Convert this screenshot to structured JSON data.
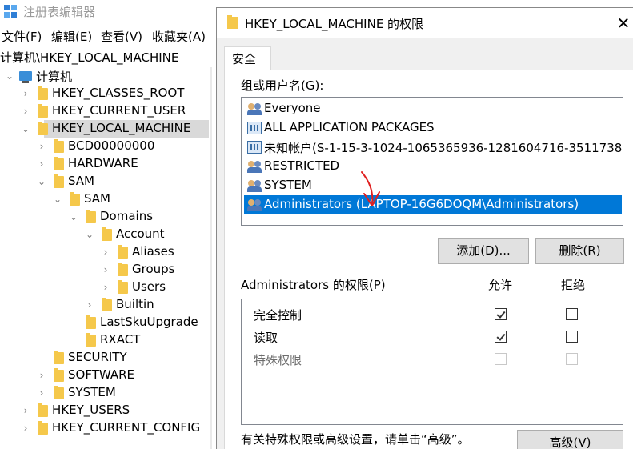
{
  "regedit": {
    "title": "注册表编辑器",
    "menu": [
      "文件(F)",
      "编辑(E)",
      "查看(V)",
      "收藏夹(A)"
    ],
    "address": "计算机\\HKEY_LOCAL_MACHINE",
    "tree": [
      {
        "label": "计算机",
        "chev": "⌄",
        "pc": true
      },
      {
        "label": "HKEY_CLASSES_ROOT",
        "chev": "›"
      },
      {
        "label": "HKEY_CURRENT_USER",
        "chev": "›"
      },
      {
        "label": "HKEY_LOCAL_MACHINE",
        "chev": "⌄",
        "selected": true
      },
      {
        "label": "BCD00000000",
        "chev": "›"
      },
      {
        "label": "HARDWARE",
        "chev": "›"
      },
      {
        "label": "SAM",
        "chev": "⌄"
      },
      {
        "label": "SAM",
        "chev": "⌄"
      },
      {
        "label": "Domains",
        "chev": "⌄"
      },
      {
        "label": "Account",
        "chev": "⌄"
      },
      {
        "label": "Aliases",
        "chev": "›"
      },
      {
        "label": "Groups",
        "chev": "›"
      },
      {
        "label": "Users",
        "chev": "›"
      },
      {
        "label": "Builtin",
        "chev": "›"
      },
      {
        "label": "LastSkuUpgrade",
        "chev": ""
      },
      {
        "label": "RXACT",
        "chev": ""
      },
      {
        "label": "SECURITY",
        "chev": ""
      },
      {
        "label": "SOFTWARE",
        "chev": "›"
      },
      {
        "label": "SYSTEM",
        "chev": "›"
      },
      {
        "label": "HKEY_USERS",
        "chev": "›"
      },
      {
        "label": "HKEY_CURRENT_CONFIG",
        "chev": "›"
      }
    ]
  },
  "dialog": {
    "title": "HKEY_LOCAL_MACHINE 的权限",
    "close_glyph": "✕",
    "tab": "安全",
    "users_label": "组或用户名(G):",
    "users": [
      {
        "name": "Everyone",
        "icon": "group-icon"
      },
      {
        "name": "ALL APPLICATION PACKAGES",
        "icon": "package-icon"
      },
      {
        "name": "未知帐户(S-1-15-3-1024-1065365936-1281604716-3511738…",
        "icon": "package-icon"
      },
      {
        "name": "RESTRICTED",
        "icon": "group-icon"
      },
      {
        "name": "SYSTEM",
        "icon": "group-icon"
      },
      {
        "name": "Administrators (LAPTOP-16G6DOQM\\Administrators)",
        "icon": "group-icon",
        "selected": true
      }
    ],
    "add_button": "添加(D)...",
    "remove_button": "删除(R)",
    "perm_label": "Administrators 的权限(P)",
    "allow_header": "允许",
    "deny_header": "拒绝",
    "permissions": [
      {
        "name": "完全控制",
        "allow": true,
        "deny": false,
        "disabled": false
      },
      {
        "name": "读取",
        "allow": true,
        "deny": false,
        "disabled": false
      },
      {
        "name": "特殊权限",
        "allow": false,
        "deny": false,
        "disabled": true
      }
    ],
    "advanced_note": "有关特殊权限或高级设置，请单击“高级”。",
    "advanced_button": "高级(V)"
  },
  "colors": {
    "selection": "#0078d7",
    "annotation": "#e02020",
    "folder": "#f5c84b"
  }
}
